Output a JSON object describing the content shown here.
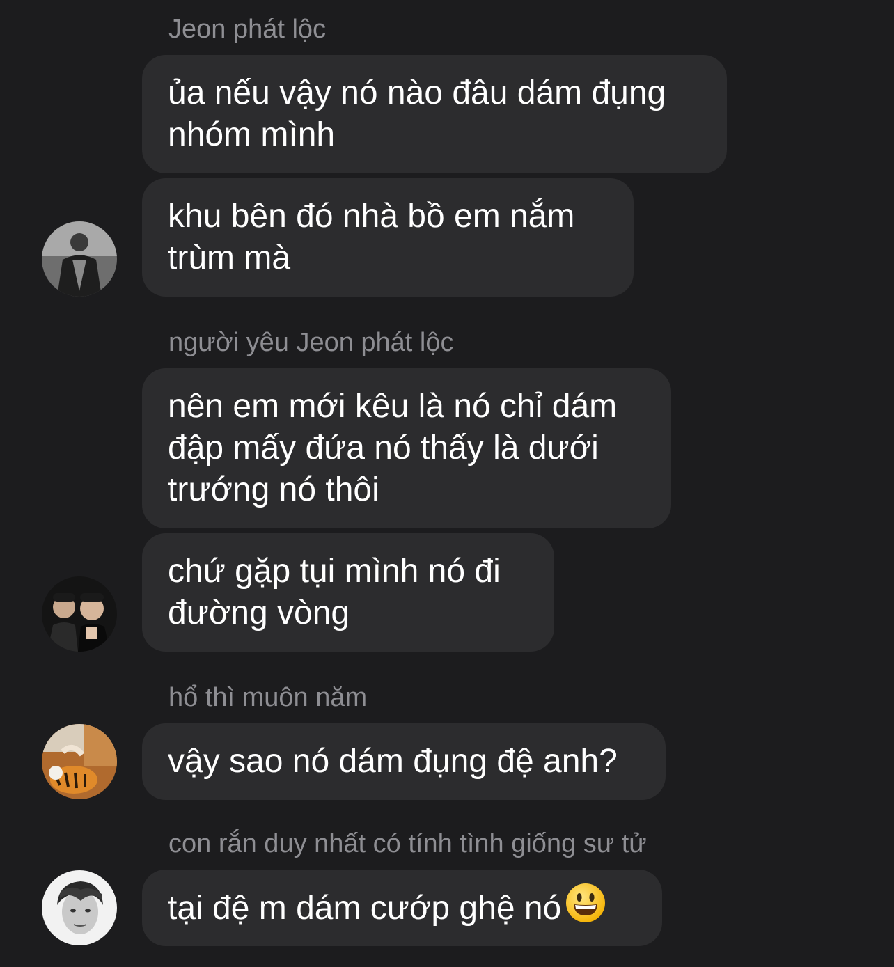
{
  "messages": [
    {
      "sender": "Jeon phát lộc",
      "bubbles": [
        "ủa nếu vậy nó nào đâu dám đụng\nnhóm mình",
        "khu bên đó nhà bồ em nắm\ntrùm mà"
      ]
    },
    {
      "sender": "người yêu Jeon phát lộc",
      "bubbles": [
        "nên em mới kêu là nó chỉ dám\nđập mấy đứa nó thấy là dưới\ntrướng nó thôi",
        "chứ gặp tụi mình nó đi\nđường vòng"
      ]
    },
    {
      "sender": "hổ thì muôn năm",
      "bubbles": [
        "vậy sao nó dám đụng đệ anh?"
      ]
    },
    {
      "sender": "con rắn duy nhất có tính tình giống sư tử",
      "bubbles": [
        "tại đệ m dám cướp ghệ nó"
      ],
      "emoji": "grinning-face"
    }
  ],
  "colors": {
    "background": "#1c1c1e",
    "bubble": "#2c2c2e",
    "sender_name": "#8e8e93",
    "message_text": "#ffffff"
  }
}
